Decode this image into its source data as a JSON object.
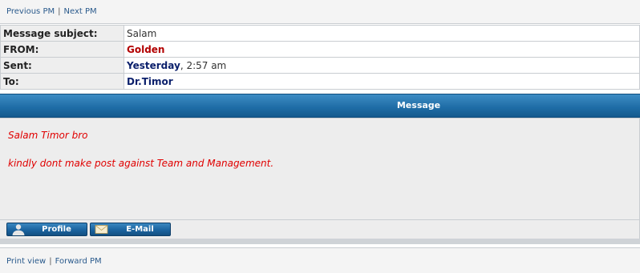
{
  "nav": {
    "previous_pm": "Previous PM",
    "next_pm": "Next PM",
    "separator": "|"
  },
  "pm_header": {
    "subject_label": "Message subject:",
    "subject_value": "Salam",
    "from_label": "FROM:",
    "from_value": "Golden",
    "sent_label": "Sent:",
    "sent_day": "Yesterday",
    "sent_time": ", 2:57 am",
    "to_label": "To:",
    "to_value": "Dr.Timor"
  },
  "message": {
    "header": "Message",
    "lines": [
      "Salam Timor bro",
      "kindly dont make post against Team and Management."
    ]
  },
  "buttons": {
    "profile": {
      "label": "Profile",
      "icon": "user-icon"
    },
    "email": {
      "label": "E-Mail",
      "icon": "envelope-icon"
    }
  },
  "footer": {
    "print_view": "Print view",
    "forward_pm": "Forward PM",
    "separator": "|"
  },
  "colors": {
    "link": "#2a5a8c",
    "header_blue": "#1e6ca5",
    "sender_red": "#b20000",
    "recipient_navy": "#0a1f6b",
    "message_text": "#e00000"
  }
}
